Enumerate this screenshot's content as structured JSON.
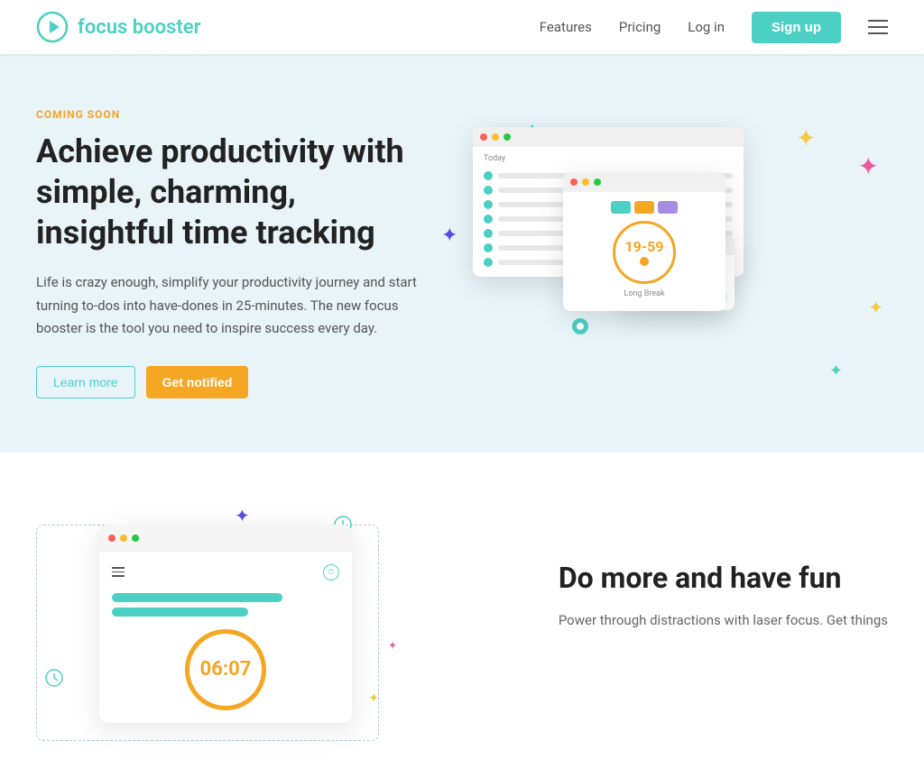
{
  "navbar": {
    "logo_text": "focus booster",
    "features_label": "Features",
    "pricing_label": "Pricing",
    "login_label": "Log in",
    "signup_label": "Sign up"
  },
  "hero": {
    "coming_soon": "COMING SOON",
    "title": "Achieve productivity with simple, charming, insightful time tracking",
    "description": "Life is crazy enough, simplify your productivity journey and start turning to-dos into have-dones in 25-minutes. The new focus booster is the tool you need to inspire success every day.",
    "learn_more_label": "Learn more",
    "get_notified_label": "Get notified"
  },
  "section2": {
    "title": "Do more and have fun",
    "description": "Power through distractions with laser focus. Get things"
  },
  "mock_timer": {
    "time": "19-59",
    "long_break": "Long Break"
  },
  "mock_timer2": {
    "time": "06:07"
  },
  "stars": {
    "teal": "✦",
    "pink": "✦",
    "yellow": "✦",
    "purple": "✦"
  }
}
